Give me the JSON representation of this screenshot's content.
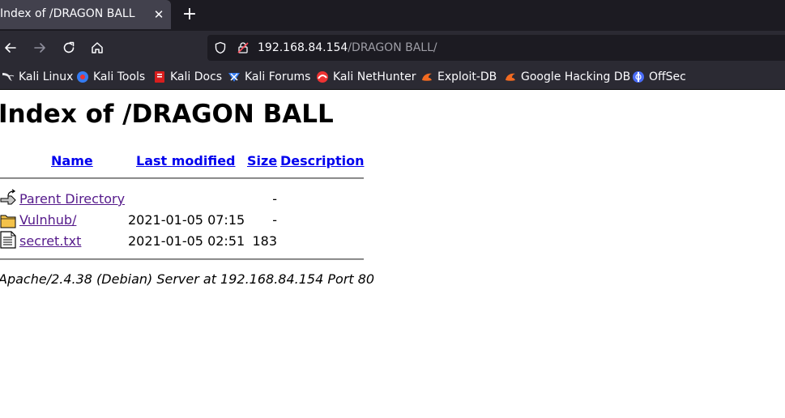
{
  "browser": {
    "tab": {
      "title": "Index of /DRAGON BALL",
      "close_icon": "close-icon"
    },
    "new_tab_icon": "plus-icon",
    "nav": {
      "back_icon": "arrow-left-icon",
      "forward_icon": "arrow-right-icon",
      "reload_icon": "reload-icon",
      "home_icon": "home-icon"
    },
    "url": {
      "host": "192.168.84.154",
      "path": "/DRAGON BALL/"
    },
    "bookmarks": [
      {
        "label": "Kali Linux",
        "icon": "kali-dragon-icon"
      },
      {
        "label": "Kali Tools",
        "icon": "kali-tools-icon"
      },
      {
        "label": "Kali Docs",
        "icon": "kali-docs-icon"
      },
      {
        "label": "Kali Forums",
        "icon": "kali-forums-icon"
      },
      {
        "label": "Kali NetHunter",
        "icon": "nethunter-icon"
      },
      {
        "label": "Exploit-DB",
        "icon": "exploit-db-icon"
      },
      {
        "label": "Google Hacking DB",
        "icon": "ghdb-icon"
      },
      {
        "label": "OffSec",
        "icon": "offsec-icon"
      }
    ],
    "colors": {
      "tabbar": "#1c1b22",
      "toolbar": "#2b2a33",
      "active_tab": "#42414d"
    }
  },
  "page": {
    "title": "Index of /DRAGON BALL",
    "columns": {
      "name": "Name",
      "modified": "Last modified",
      "size": "Size",
      "description": "Description"
    },
    "rows": [
      {
        "name": "Parent Directory",
        "modified": "",
        "size": "-",
        "icon": "back-folder-icon"
      },
      {
        "name": "Vulnhub/",
        "modified": "2021-01-05 07:15",
        "size": "-",
        "icon": "folder-icon"
      },
      {
        "name": "secret.txt",
        "modified": "2021-01-05 02:51",
        "size": "183",
        "icon": "text-file-icon"
      }
    ],
    "footer": "Apache/2.4.38 (Debian) Server at 192.168.84.154 Port 80",
    "colors": {
      "link": "#0000ee",
      "visited": "#551a8b"
    }
  }
}
